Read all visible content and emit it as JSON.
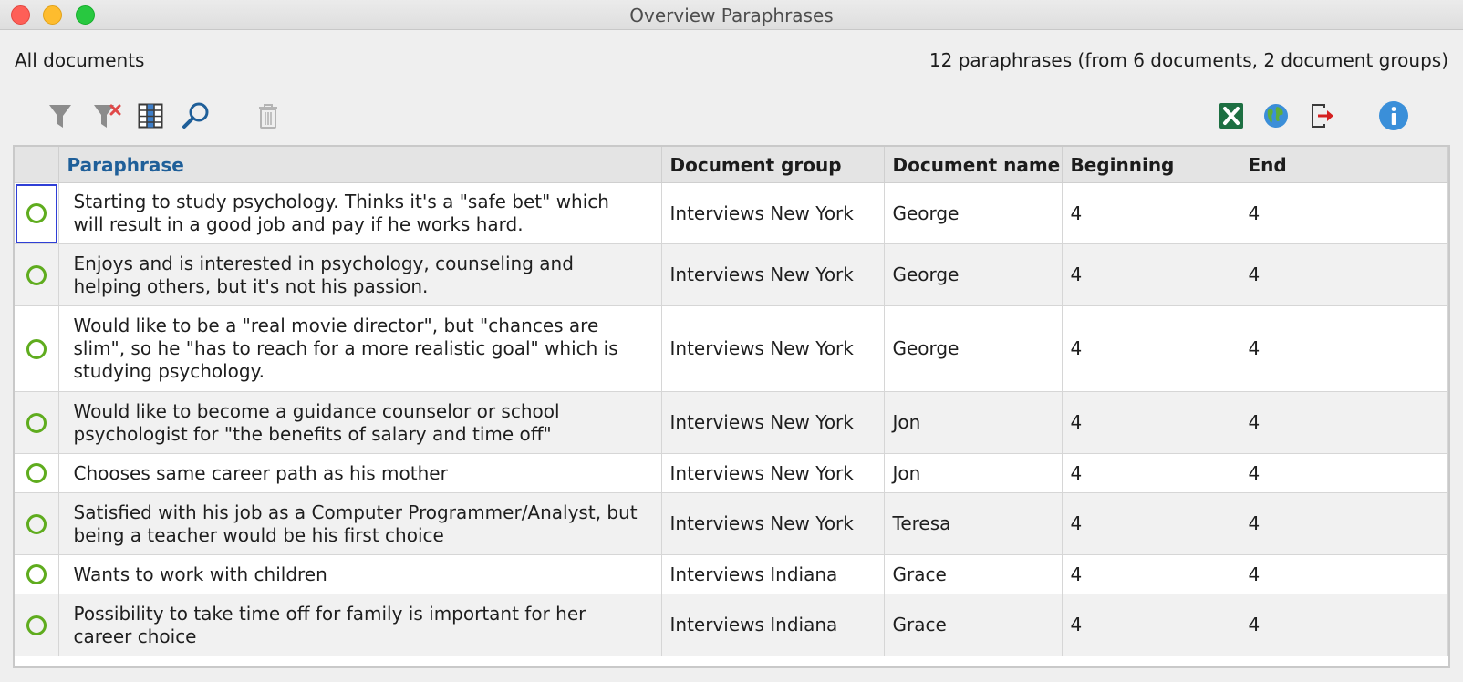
{
  "window": {
    "title": "Overview Paraphrases"
  },
  "scope_label": "All documents",
  "summary": "12 paraphrases (from 6 documents, 2 document groups)",
  "toolbar": {
    "left": [
      {
        "name": "filter-icon"
      },
      {
        "name": "clear-filter-icon"
      },
      {
        "name": "select-columns-icon"
      },
      {
        "name": "search-icon"
      },
      {
        "name": "delete-icon"
      }
    ],
    "right": [
      {
        "name": "excel-export-icon",
        "color": "#1d6f42"
      },
      {
        "name": "html-export-icon",
        "color": "#3b8ed8"
      },
      {
        "name": "export-icon",
        "color": "#d42020"
      },
      {
        "name": "info-icon",
        "color": "#3a8fd9"
      }
    ]
  },
  "table": {
    "columns": [
      "Paraphrase",
      "Document group",
      "Document name",
      "Beginning",
      "End"
    ],
    "sorted_column": "Paraphrase",
    "rows": [
      {
        "paraphrase": "Starting to study psychology. Thinks it's a \"safe bet\" which will result in a good job and pay if he works hard.",
        "group": "Interviews New York",
        "document": "George",
        "beginning": "4",
        "end": "4"
      },
      {
        "paraphrase": "Enjoys and is interested in psychology, counseling and helping others, but it's not his passion.",
        "group": "Interviews New York",
        "document": "George",
        "beginning": "4",
        "end": "4"
      },
      {
        "paraphrase": "Would like to be a \"real movie director\", but \"chances are slim\", so he \"has to reach for a more realistic goal\" which is studying psychology.",
        "group": "Interviews New York",
        "document": "George",
        "beginning": "4",
        "end": "4"
      },
      {
        "paraphrase": "Would like to become a guidance counselor or school psychologist for \"the benefits of salary and time off\"",
        "group": "Interviews New York",
        "document": "Jon",
        "beginning": "4",
        "end": "4"
      },
      {
        "paraphrase": "Chooses same career path as his mother",
        "group": "Interviews New York",
        "document": "Jon",
        "beginning": "4",
        "end": "4"
      },
      {
        "paraphrase": "Satisfied with his job as a Computer Programmer/Analyst, but being a teacher would be his first choice",
        "group": "Interviews New York",
        "document": "Teresa",
        "beginning": "4",
        "end": "4"
      },
      {
        "paraphrase": "Wants to work with children",
        "group": "Interviews Indiana",
        "document": "Grace",
        "beginning": "4",
        "end": "4"
      },
      {
        "paraphrase": "Possibility to take time off for family is important for her career choice",
        "group": "Interviews Indiana",
        "document": "Grace",
        "beginning": "4",
        "end": "4"
      }
    ]
  }
}
